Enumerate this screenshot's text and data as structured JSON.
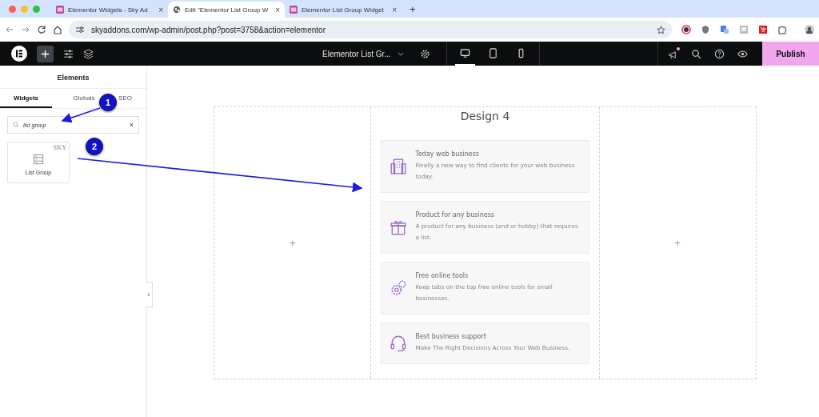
{
  "browser": {
    "tabs": [
      {
        "title": "Elementor Widgets - Sky Ad",
        "selected": false
      },
      {
        "title": "Edit \"Elementor List Group W",
        "selected": true
      },
      {
        "title": "Elementor List Group Widget",
        "selected": false
      }
    ],
    "new_tab": "+",
    "close": "×",
    "url": "skyaddons.com/wp-admin/post.php?post=3758&action=elementor"
  },
  "editor_bar": {
    "document_title": "Elementor List Gr...",
    "devices": [
      {
        "selected": true
      },
      {
        "selected": false
      },
      {
        "selected": false
      }
    ],
    "notification": true,
    "publish": "Publish"
  },
  "sidebar": {
    "title": "Elements",
    "tabs": [
      {
        "label": "Widgets",
        "selected": true
      },
      {
        "label": "Globals",
        "selected": false
      },
      {
        "label": "SEO",
        "selected": false
      }
    ],
    "search": {
      "value": "list group",
      "clear": "×"
    },
    "widgets": [
      {
        "label": "List Group",
        "badge": "SKY"
      }
    ],
    "collapse": "‹"
  },
  "canvas": {
    "add_marks": [
      "+",
      "+"
    ],
    "heading": "Design 4",
    "items": [
      {
        "title": "Today web business",
        "text": "Finally a new way to find clients for your web business today."
      },
      {
        "title": "Product for any business",
        "text": "A product for any business (and or hobby) that requires a list."
      },
      {
        "title": "Free online tools",
        "text": "Keep tabs on the top free online tools for small businesses."
      },
      {
        "title": "Best business support",
        "text": "Make The Right Decisions Across Your Web Business."
      }
    ]
  },
  "annotations": [
    "1",
    "2"
  ]
}
